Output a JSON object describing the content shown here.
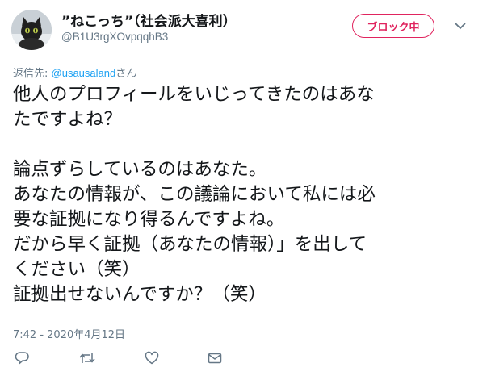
{
  "user": {
    "name": "”ねこっち”（社会派大喜利）",
    "handle": "@B1U3rgXOvpqqhB3"
  },
  "block_button": {
    "label": "ブロック中"
  },
  "reply": {
    "prefix": "返信先: ",
    "mention": "@usausaland",
    "suffix": "さん"
  },
  "body": {
    "lines": [
      "他人のプロフィールをいじってきたのはあな",
      "たですよね？",
      "",
      "論点ずらしているのはあなた。",
      "あなたの情報が、この議論において私には必",
      "要な証拠になり得るんですよね。",
      "だから早く証拠（あなたの情報）」を出して",
      "ください（笑）",
      "証拠出せないんですか？（笑）"
    ]
  },
  "timestamp": "7:42 - 2020年4月12日",
  "colors": {
    "accent_block": "#e0245e",
    "link": "#1da1f2",
    "muted": "#657786",
    "highlight": "#fff200"
  },
  "icons": {
    "reply": "reply-icon",
    "retweet": "retweet-icon",
    "like": "heart-icon",
    "dm": "envelope-icon",
    "more": "chevron-down-icon"
  }
}
